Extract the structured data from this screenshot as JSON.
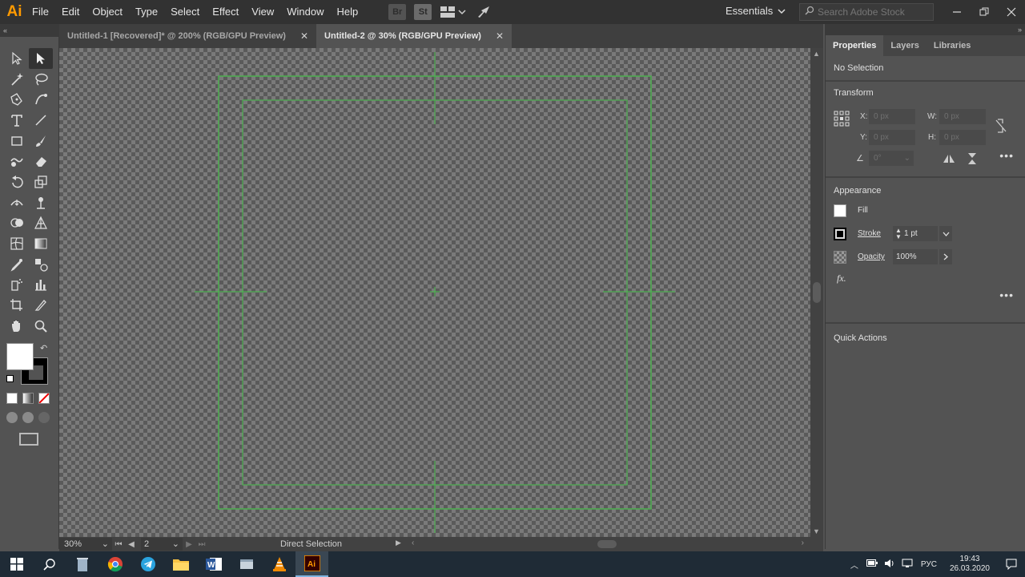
{
  "app": {
    "logo": "Ai",
    "menu": [
      "File",
      "Edit",
      "Object",
      "Type",
      "Select",
      "Effect",
      "View",
      "Window",
      "Help"
    ],
    "bridge_label": "Br",
    "stock_label": "St",
    "workspace": "Essentials",
    "search_placeholder": "Search Adobe Stock"
  },
  "tabs": [
    {
      "label": "Untitled-1 [Recovered]* @ 200% (RGB/GPU Preview)",
      "active": false
    },
    {
      "label": "Untitled-2 @ 30% (RGB/GPU Preview)",
      "active": true
    }
  ],
  "toolbar": {
    "collapse": "«",
    "tools": [
      "selection-tool",
      "direct-selection-tool",
      "magic-wand-tool",
      "lasso-tool",
      "pen-tool",
      "curvature-tool",
      "type-tool",
      "line-segment-tool",
      "rectangle-tool",
      "paintbrush-tool",
      "shaper-tool",
      "eraser-tool",
      "rotate-tool",
      "scale-tool",
      "width-tool",
      "puppet-warp-tool",
      "shape-builder-tool",
      "perspective-grid-tool",
      "mesh-tool",
      "gradient-tool",
      "eyedropper-tool",
      "blend-tool",
      "symbol-sprayer-tool",
      "column-graph-tool",
      "artboard-tool",
      "slice-tool",
      "hand-tool",
      "zoom-tool"
    ],
    "active_tool": "direct-selection-tool"
  },
  "status": {
    "zoom": "30%",
    "artboard": "2",
    "text": "Direct Selection"
  },
  "panel": {
    "collapse": "»",
    "tabs": [
      "Properties",
      "Layers",
      "Libraries"
    ],
    "no_selection": "No Selection",
    "transform": {
      "title": "Transform",
      "x_label": "X:",
      "x_value": "0 px",
      "y_label": "Y:",
      "y_value": "0 px",
      "w_label": "W:",
      "w_value": "0 px",
      "h_label": "H:",
      "h_value": "0 px",
      "angle_value": "0°"
    },
    "appearance": {
      "title": "Appearance",
      "fill_label": "Fill",
      "stroke_label": "Stroke",
      "stroke_weight": "1 pt",
      "opacity_label": "Opacity",
      "opacity_value": "100%",
      "fx_label": "fx."
    },
    "quick_actions": "Quick Actions"
  },
  "taskbar": {
    "language": "РУС",
    "time": "19:43",
    "date": "26.03.2020"
  },
  "colors": {
    "guide": "#4caf50",
    "accent": "#ff9a00"
  }
}
